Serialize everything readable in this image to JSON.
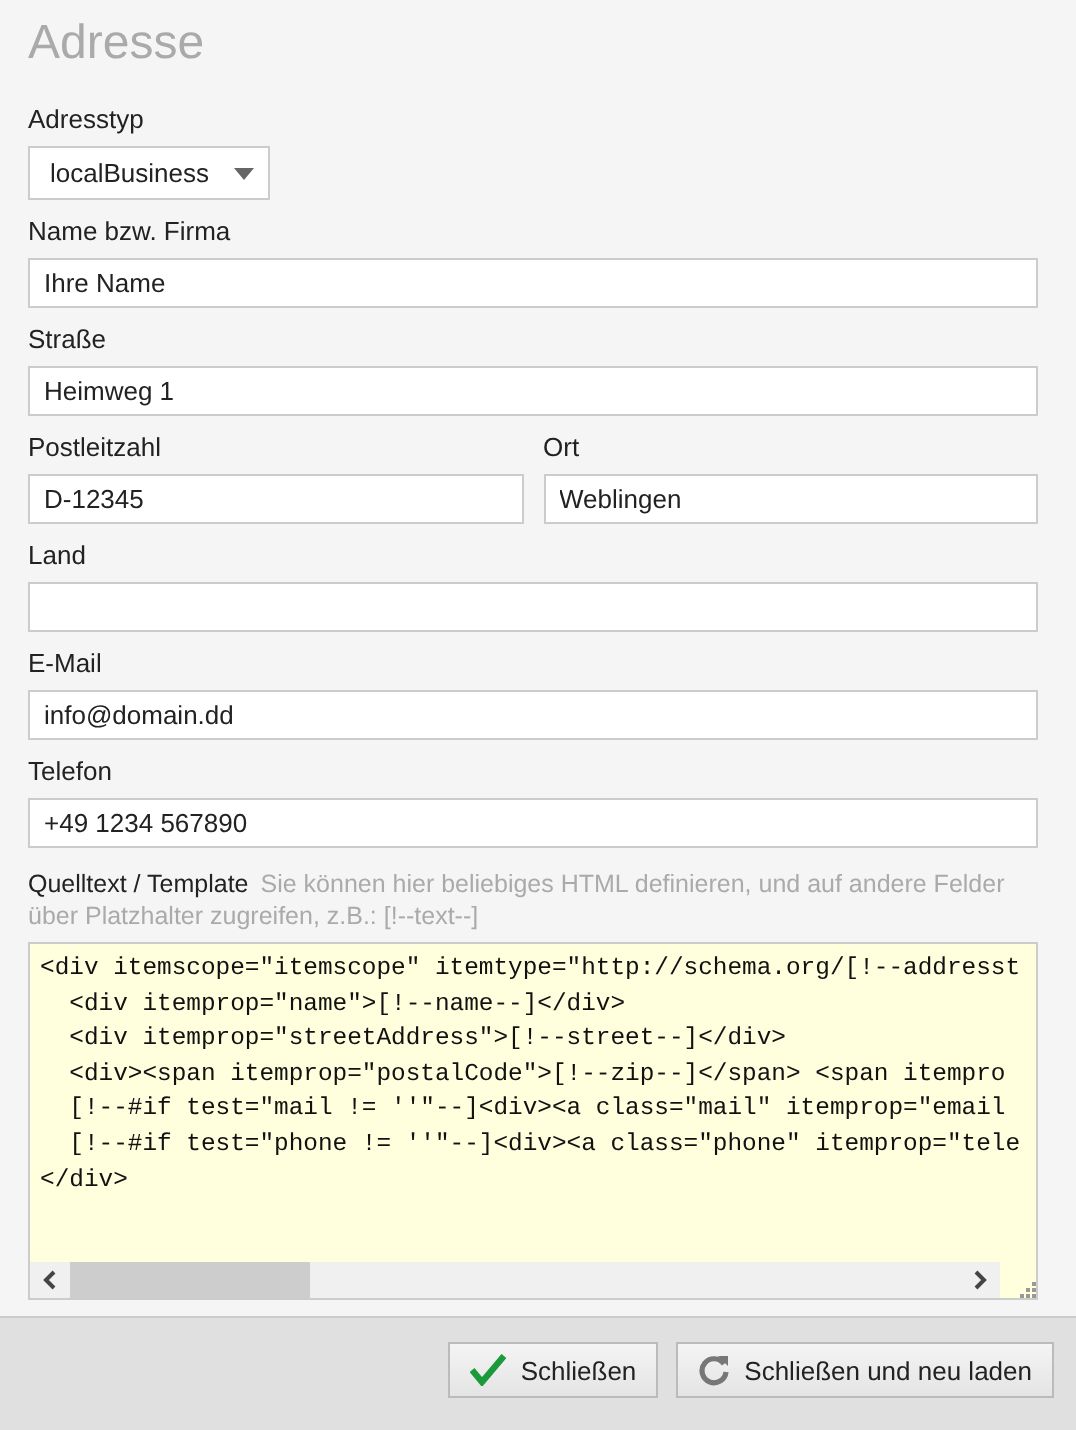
{
  "title": "Adresse",
  "rows": [
    {
      "fields": [
        {
          "kind": "select",
          "label": "Adresstyp",
          "value": "localBusiness"
        }
      ]
    },
    {
      "fields": [
        {
          "kind": "text",
          "label": "Name bzw. Firma",
          "value": "Ihre Name"
        }
      ]
    },
    {
      "fields": [
        {
          "kind": "text",
          "label": "Straße",
          "value": "Heimweg 1"
        }
      ]
    },
    {
      "fields": [
        {
          "kind": "text",
          "label": "Postleitzahl",
          "value": "D-12345"
        },
        {
          "kind": "text",
          "label": "Ort",
          "value": "Weblingen"
        }
      ]
    },
    {
      "fields": [
        {
          "kind": "text",
          "label": "Land"
        }
      ]
    },
    {
      "fields": [
        {
          "kind": "text",
          "label": "E-Mail",
          "value": "info@domain.dd"
        }
      ]
    },
    {
      "fields": [
        {
          "kind": "text",
          "label": "Telefon",
          "value": "+49 1234 567890"
        }
      ]
    }
  ],
  "template": {
    "label": "Quelltext / Template",
    "hint": "Sie können hier beliebiges HTML definieren, und auf andere Felder über Platzhalter zugreifen, z.B.: [!--text--]",
    "lines": [
      "<div itemscope=\"itemscope\" itemtype=\"http://schema.org/[!--addresst",
      "  <div itemprop=\"name\">[!--name--]</div>",
      "  <div itemprop=\"streetAddress\">[!--street--]</div>",
      "  <div><span itemprop=\"postalCode\">[!--zip--]</span> <span itempro",
      "  [!--#if test=\"mail != ''\"--]<div><a class=\"mail\" itemprop=\"email",
      "  [!--#if test=\"phone != ''\"--]<div><a class=\"phone\" itemprop=\"tele",
      "</div>"
    ]
  },
  "buttons": [
    {
      "kind": "check",
      "label": "Schließen"
    },
    {
      "kind": "reload",
      "label": "Schließen und neu laden"
    }
  ]
}
